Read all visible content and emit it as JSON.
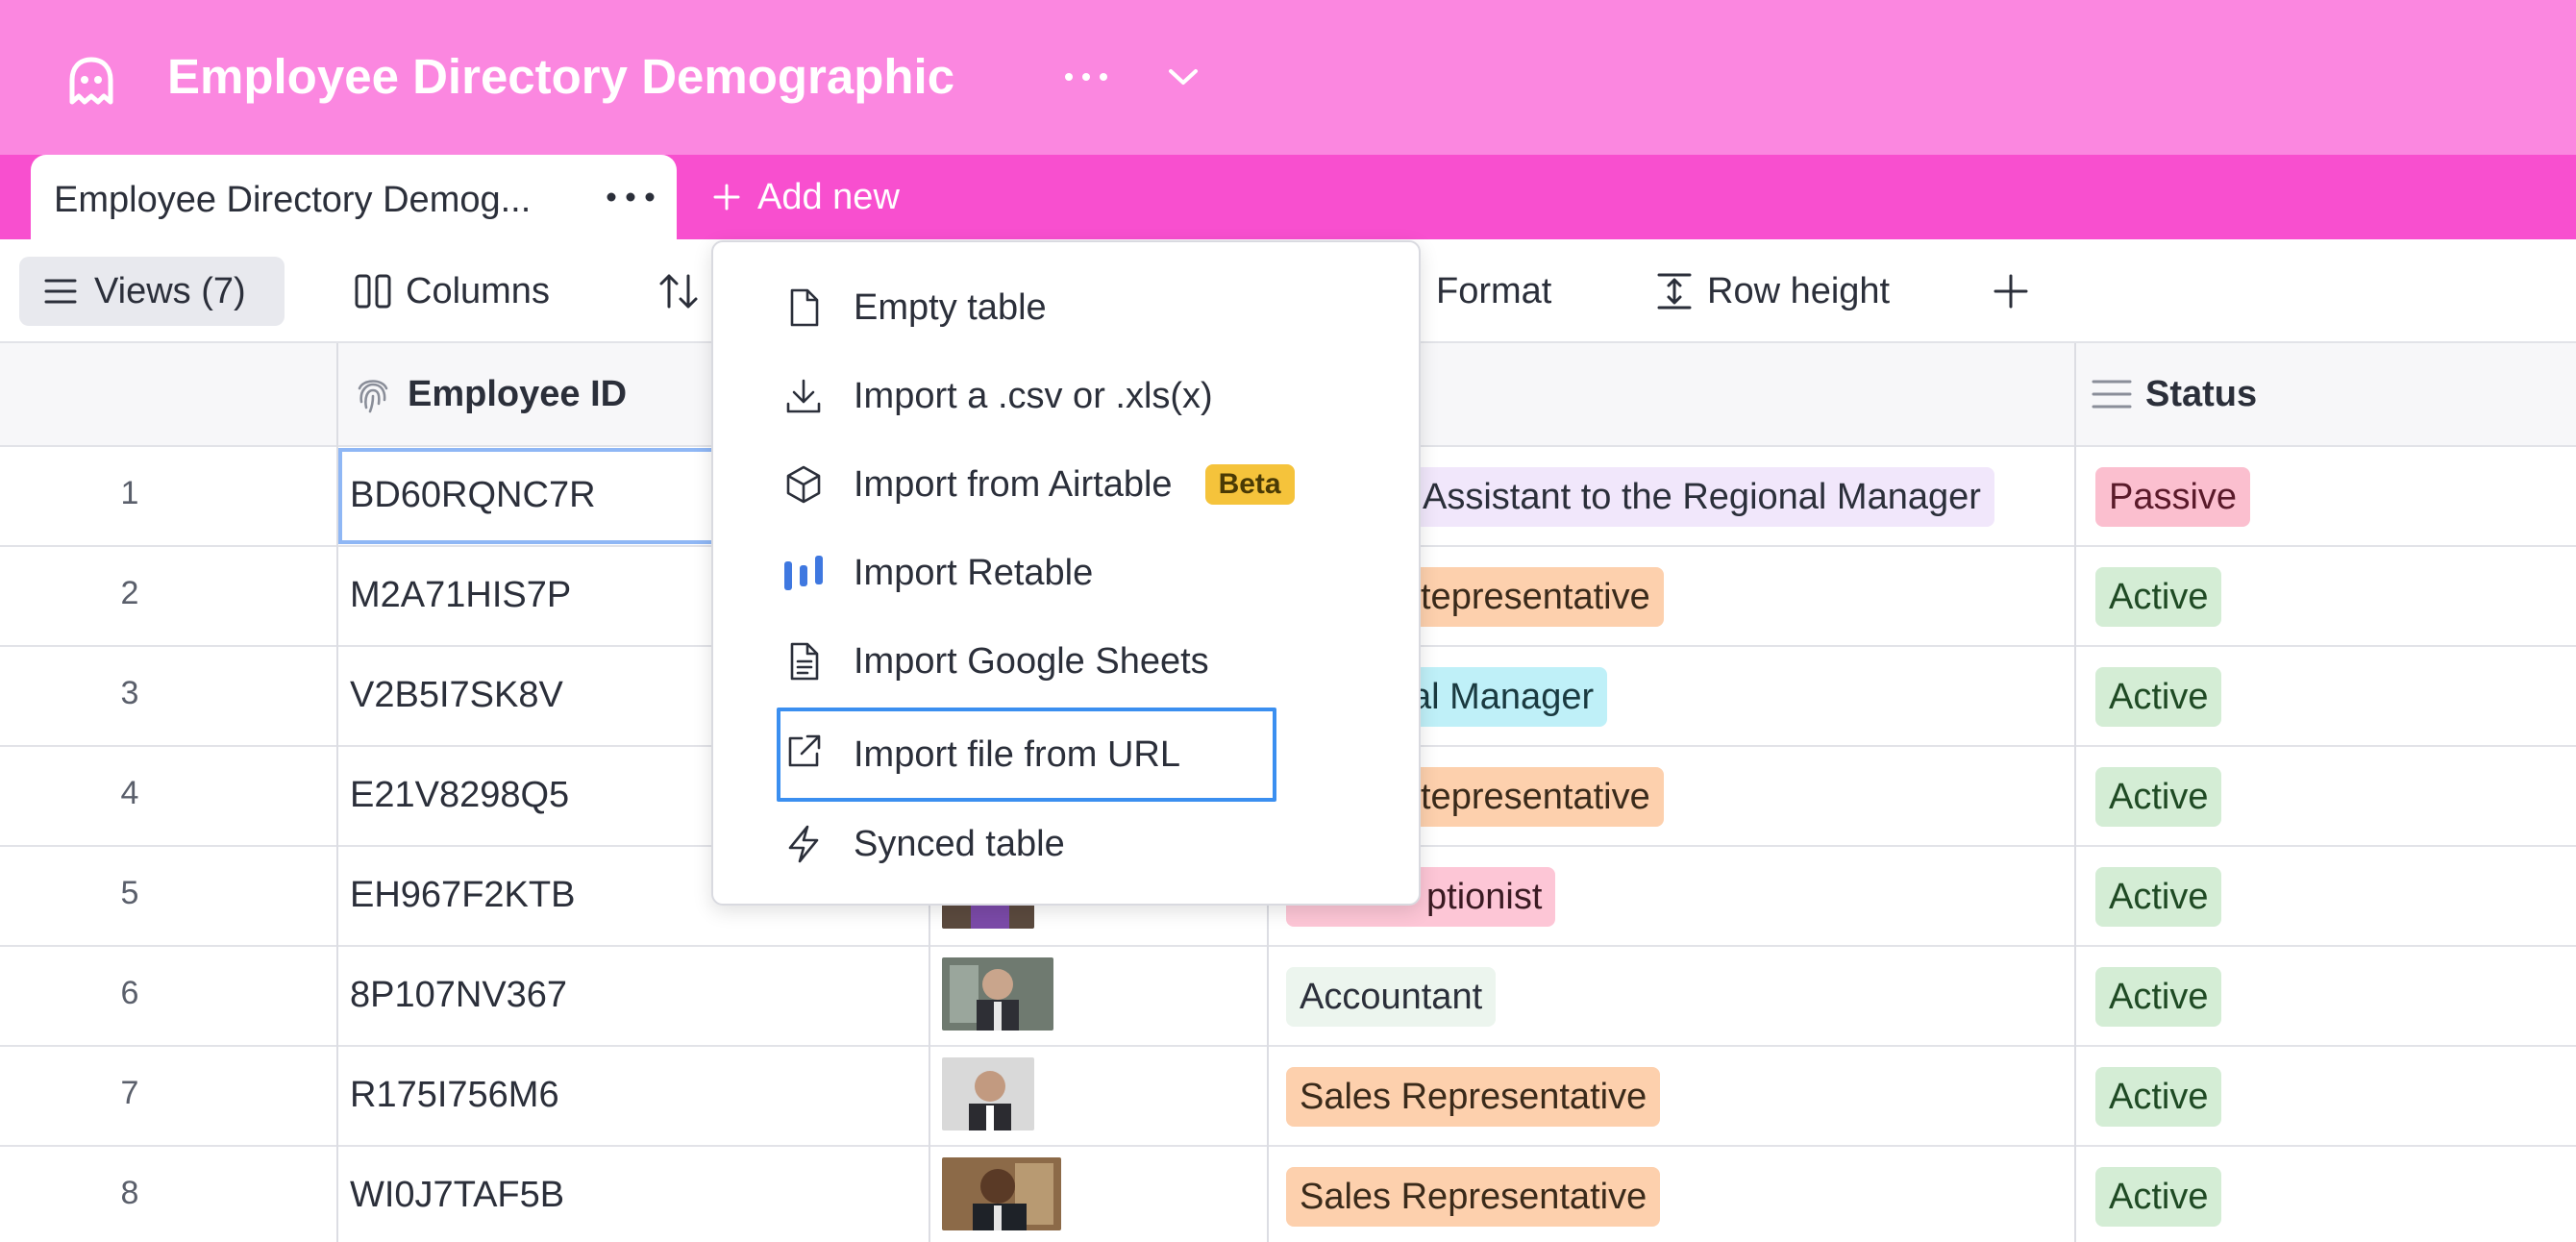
{
  "app": {
    "title": "Employee Directory Demographic",
    "accent_top": "#fb87e0",
    "accent_tabs": "#f84fcf"
  },
  "tabs": [
    {
      "label": "Employee Directory Demog..."
    }
  ],
  "add_new_label": "Add new",
  "toolbar": {
    "views_label": "Views (7)",
    "columns_label": "Columns",
    "format_label": "Format",
    "row_height_label": "Row height"
  },
  "columns": {
    "employee_id": "Employee ID",
    "status": "Status"
  },
  "rows": [
    {
      "num": "1",
      "id": "BD60RQNC7R",
      "job": "Assistant to the Regional Manager",
      "status": "Passive"
    },
    {
      "num": "2",
      "id": "M2A71HIS7P",
      "job": "Sales Representative",
      "status": "Active"
    },
    {
      "num": "3",
      "id": "V2B5I7SK8V",
      "job": "Regional Manager",
      "status": "Active"
    },
    {
      "num": "4",
      "id": "E21V8298Q5",
      "job": "Sales Representative",
      "status": "Active"
    },
    {
      "num": "5",
      "id": "EH967F2KTB",
      "job": "Receptionist",
      "status": "Active"
    },
    {
      "num": "6",
      "id": "8P107NV367",
      "job": "Accountant",
      "status": "Active"
    },
    {
      "num": "7",
      "id": "R175I756M6",
      "job": "Sales Representative",
      "status": "Active"
    },
    {
      "num": "8",
      "id": "WI0J7TAF5B",
      "job": "Sales Representative",
      "status": "Active"
    }
  ],
  "visible_job_text": {
    "r1": "Assistant to the Regional Manager",
    "r2": "tepresentative",
    "r3": "al Manager",
    "r4": "tepresentative",
    "r5": "ptionist",
    "r6": "Accountant",
    "r7": "Sales Representative",
    "r8": "Sales Representative"
  },
  "menu": {
    "items": [
      {
        "label": "Empty table",
        "icon": "file-icon"
      },
      {
        "label": "Import a .csv or .xls(x)",
        "icon": "download-icon"
      },
      {
        "label": "Import from Airtable",
        "icon": "cube-icon",
        "badge": "Beta"
      },
      {
        "label": "Import Retable",
        "icon": "retable-icon"
      },
      {
        "label": "Import Google Sheets",
        "icon": "sheet-icon"
      },
      {
        "label": "Import file from URL",
        "icon": "external-link-icon"
      },
      {
        "label": "Synced table",
        "icon": "lightning-icon"
      }
    ]
  },
  "colors": {
    "pill_purple": "#f1e7fb",
    "pill_orange": "#fdd0ad",
    "pill_cyan": "#bff0f8",
    "pill_pink": "#fdc6d6",
    "pill_mint": "#ecf5ee",
    "status_active": "#d4edd5",
    "status_passive": "#fbbfcf",
    "selection": "#3b8ff0"
  }
}
